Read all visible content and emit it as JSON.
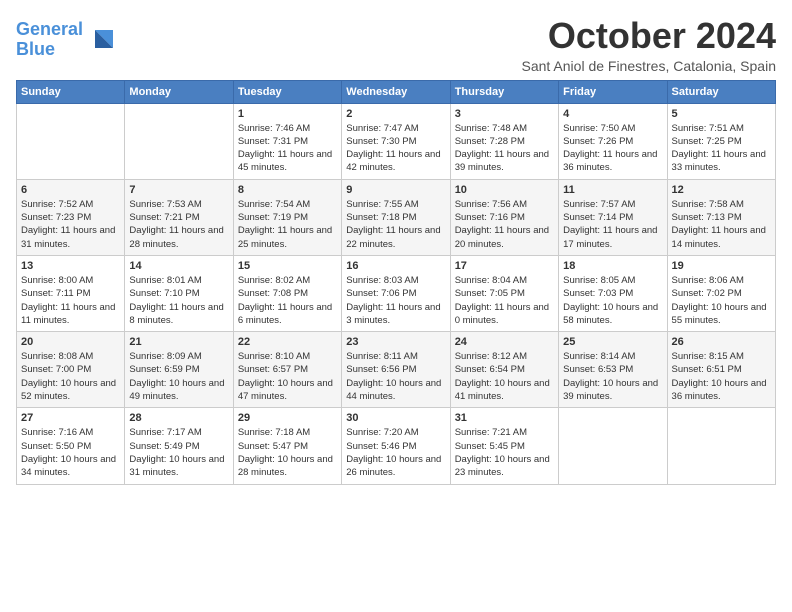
{
  "logo": {
    "line1": "General",
    "line2": "Blue"
  },
  "title": "October 2024",
  "subtitle": "Sant Aniol de Finestres, Catalonia, Spain",
  "days_of_week": [
    "Sunday",
    "Monday",
    "Tuesday",
    "Wednesday",
    "Thursday",
    "Friday",
    "Saturday"
  ],
  "weeks": [
    [
      {
        "day": "",
        "detail": ""
      },
      {
        "day": "",
        "detail": ""
      },
      {
        "day": "1",
        "detail": "Sunrise: 7:46 AM\nSunset: 7:31 PM\nDaylight: 11 hours and 45 minutes."
      },
      {
        "day": "2",
        "detail": "Sunrise: 7:47 AM\nSunset: 7:30 PM\nDaylight: 11 hours and 42 minutes."
      },
      {
        "day": "3",
        "detail": "Sunrise: 7:48 AM\nSunset: 7:28 PM\nDaylight: 11 hours and 39 minutes."
      },
      {
        "day": "4",
        "detail": "Sunrise: 7:50 AM\nSunset: 7:26 PM\nDaylight: 11 hours and 36 minutes."
      },
      {
        "day": "5",
        "detail": "Sunrise: 7:51 AM\nSunset: 7:25 PM\nDaylight: 11 hours and 33 minutes."
      }
    ],
    [
      {
        "day": "6",
        "detail": "Sunrise: 7:52 AM\nSunset: 7:23 PM\nDaylight: 11 hours and 31 minutes."
      },
      {
        "day": "7",
        "detail": "Sunrise: 7:53 AM\nSunset: 7:21 PM\nDaylight: 11 hours and 28 minutes."
      },
      {
        "day": "8",
        "detail": "Sunrise: 7:54 AM\nSunset: 7:19 PM\nDaylight: 11 hours and 25 minutes."
      },
      {
        "day": "9",
        "detail": "Sunrise: 7:55 AM\nSunset: 7:18 PM\nDaylight: 11 hours and 22 minutes."
      },
      {
        "day": "10",
        "detail": "Sunrise: 7:56 AM\nSunset: 7:16 PM\nDaylight: 11 hours and 20 minutes."
      },
      {
        "day": "11",
        "detail": "Sunrise: 7:57 AM\nSunset: 7:14 PM\nDaylight: 11 hours and 17 minutes."
      },
      {
        "day": "12",
        "detail": "Sunrise: 7:58 AM\nSunset: 7:13 PM\nDaylight: 11 hours and 14 minutes."
      }
    ],
    [
      {
        "day": "13",
        "detail": "Sunrise: 8:00 AM\nSunset: 7:11 PM\nDaylight: 11 hours and 11 minutes."
      },
      {
        "day": "14",
        "detail": "Sunrise: 8:01 AM\nSunset: 7:10 PM\nDaylight: 11 hours and 8 minutes."
      },
      {
        "day": "15",
        "detail": "Sunrise: 8:02 AM\nSunset: 7:08 PM\nDaylight: 11 hours and 6 minutes."
      },
      {
        "day": "16",
        "detail": "Sunrise: 8:03 AM\nSunset: 7:06 PM\nDaylight: 11 hours and 3 minutes."
      },
      {
        "day": "17",
        "detail": "Sunrise: 8:04 AM\nSunset: 7:05 PM\nDaylight: 11 hours and 0 minutes."
      },
      {
        "day": "18",
        "detail": "Sunrise: 8:05 AM\nSunset: 7:03 PM\nDaylight: 10 hours and 58 minutes."
      },
      {
        "day": "19",
        "detail": "Sunrise: 8:06 AM\nSunset: 7:02 PM\nDaylight: 10 hours and 55 minutes."
      }
    ],
    [
      {
        "day": "20",
        "detail": "Sunrise: 8:08 AM\nSunset: 7:00 PM\nDaylight: 10 hours and 52 minutes."
      },
      {
        "day": "21",
        "detail": "Sunrise: 8:09 AM\nSunset: 6:59 PM\nDaylight: 10 hours and 49 minutes."
      },
      {
        "day": "22",
        "detail": "Sunrise: 8:10 AM\nSunset: 6:57 PM\nDaylight: 10 hours and 47 minutes."
      },
      {
        "day": "23",
        "detail": "Sunrise: 8:11 AM\nSunset: 6:56 PM\nDaylight: 10 hours and 44 minutes."
      },
      {
        "day": "24",
        "detail": "Sunrise: 8:12 AM\nSunset: 6:54 PM\nDaylight: 10 hours and 41 minutes."
      },
      {
        "day": "25",
        "detail": "Sunrise: 8:14 AM\nSunset: 6:53 PM\nDaylight: 10 hours and 39 minutes."
      },
      {
        "day": "26",
        "detail": "Sunrise: 8:15 AM\nSunset: 6:51 PM\nDaylight: 10 hours and 36 minutes."
      }
    ],
    [
      {
        "day": "27",
        "detail": "Sunrise: 7:16 AM\nSunset: 5:50 PM\nDaylight: 10 hours and 34 minutes."
      },
      {
        "day": "28",
        "detail": "Sunrise: 7:17 AM\nSunset: 5:49 PM\nDaylight: 10 hours and 31 minutes."
      },
      {
        "day": "29",
        "detail": "Sunrise: 7:18 AM\nSunset: 5:47 PM\nDaylight: 10 hours and 28 minutes."
      },
      {
        "day": "30",
        "detail": "Sunrise: 7:20 AM\nSunset: 5:46 PM\nDaylight: 10 hours and 26 minutes."
      },
      {
        "day": "31",
        "detail": "Sunrise: 7:21 AM\nSunset: 5:45 PM\nDaylight: 10 hours and 23 minutes."
      },
      {
        "day": "",
        "detail": ""
      },
      {
        "day": "",
        "detail": ""
      }
    ]
  ]
}
